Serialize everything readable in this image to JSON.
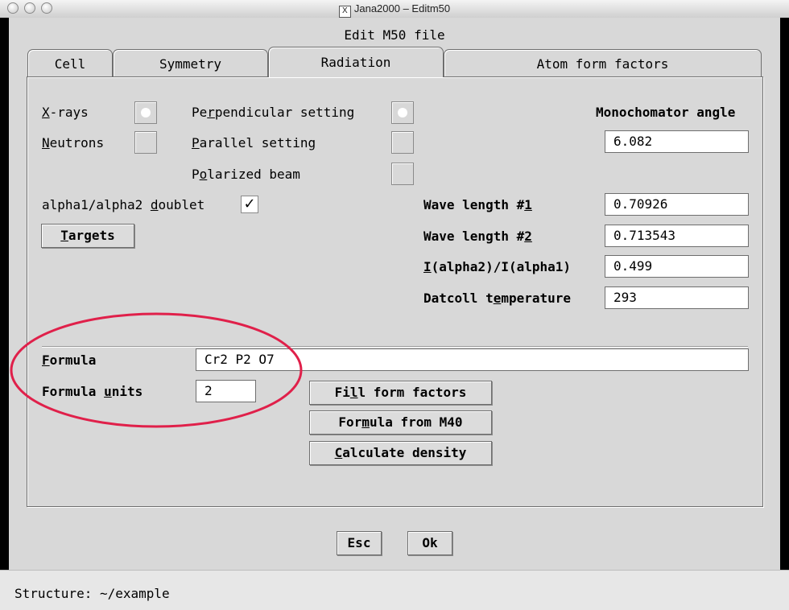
{
  "window": {
    "title": "Jana2000 – Editm50",
    "x_glyph": "X"
  },
  "dialog": {
    "title": "Edit M50 file"
  },
  "tabs": [
    {
      "label": "Cell",
      "active": false
    },
    {
      "label": "Symmetry",
      "active": false
    },
    {
      "label": "Radiation",
      "active": true
    },
    {
      "label": "Atom form factors",
      "active": false
    }
  ],
  "radiation": {
    "xrays": {
      "pre": "",
      "u": "X",
      "post": "-rays",
      "selected": true
    },
    "neutrons": {
      "pre": "",
      "u": "N",
      "post": "eutrons",
      "selected": false
    },
    "perpendicular": {
      "pre": "Pe",
      "u": "r",
      "post": "pendicular setting",
      "selected": true
    },
    "parallel": {
      "pre": "",
      "u": "P",
      "post": "arallel setting",
      "selected": false
    },
    "polarized": {
      "pre": "P",
      "u": "o",
      "post": "larized beam",
      "selected": false
    },
    "doublet": {
      "pre": "alpha1/alpha2 ",
      "u": "d",
      "post": "oublet",
      "checked": true,
      "check_glyph": "✓"
    },
    "targets_button": {
      "pre": "",
      "u": "T",
      "post": "argets"
    },
    "monochromator": {
      "label": "Monochomator angle",
      "value": "6.082"
    },
    "wave1": {
      "pre": "Wave length #",
      "u": "1",
      "post": "",
      "value": "0.70926"
    },
    "wave2": {
      "pre": "Wave length #",
      "u": "2",
      "post": "",
      "value": "0.713543"
    },
    "ratio": {
      "pre": "",
      "u": "I",
      "post": "(alpha2)/I(alpha1)",
      "value": "0.499"
    },
    "temperature": {
      "pre": "Datcoll t",
      "u": "e",
      "post": "mperature",
      "value": "293"
    }
  },
  "formula": {
    "formula": {
      "pre": "",
      "u": "F",
      "post": "ormula",
      "value": "Cr2 P2 O7"
    },
    "units": {
      "pre": "Formula ",
      "u": "u",
      "post": "nits",
      "value": "2"
    },
    "fill_button": {
      "pre": "Fi",
      "u": "l",
      "post": "l form factors"
    },
    "from_m40_button": {
      "pre": "For",
      "u": "m",
      "post": "ula from M40"
    },
    "density_button": {
      "pre": "",
      "u": "C",
      "post": "alculate density"
    }
  },
  "footer": {
    "esc": "Esc",
    "ok": "Ok"
  },
  "status": {
    "text": "Structure: ~/example"
  },
  "colors": {
    "annotation_ellipse": "#e0204a",
    "background": "#d8d8d8"
  }
}
